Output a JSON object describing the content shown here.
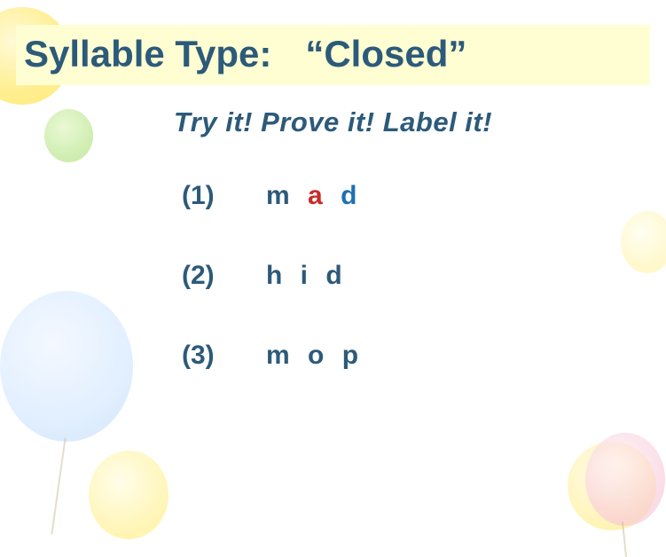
{
  "title": {
    "label": "Syllable Type:",
    "value": "“Closed”"
  },
  "subtitle": "Try it!  Prove it! Label it!",
  "items": [
    {
      "num": "(1)",
      "letters": [
        {
          "ch": "m",
          "color": "teal"
        },
        {
          "ch": "a",
          "color": "red"
        },
        {
          "ch": "d",
          "color": "blue"
        }
      ]
    },
    {
      "num": "(2)",
      "letters": [
        {
          "ch": "h",
          "color": "teal"
        },
        {
          "ch": "i",
          "color": "teal"
        },
        {
          "ch": "d",
          "color": "teal"
        }
      ]
    },
    {
      "num": "(3)",
      "letters": [
        {
          "ch": "m",
          "color": "teal"
        },
        {
          "ch": "o",
          "color": "teal"
        },
        {
          "ch": "p",
          "color": "teal"
        }
      ]
    }
  ]
}
